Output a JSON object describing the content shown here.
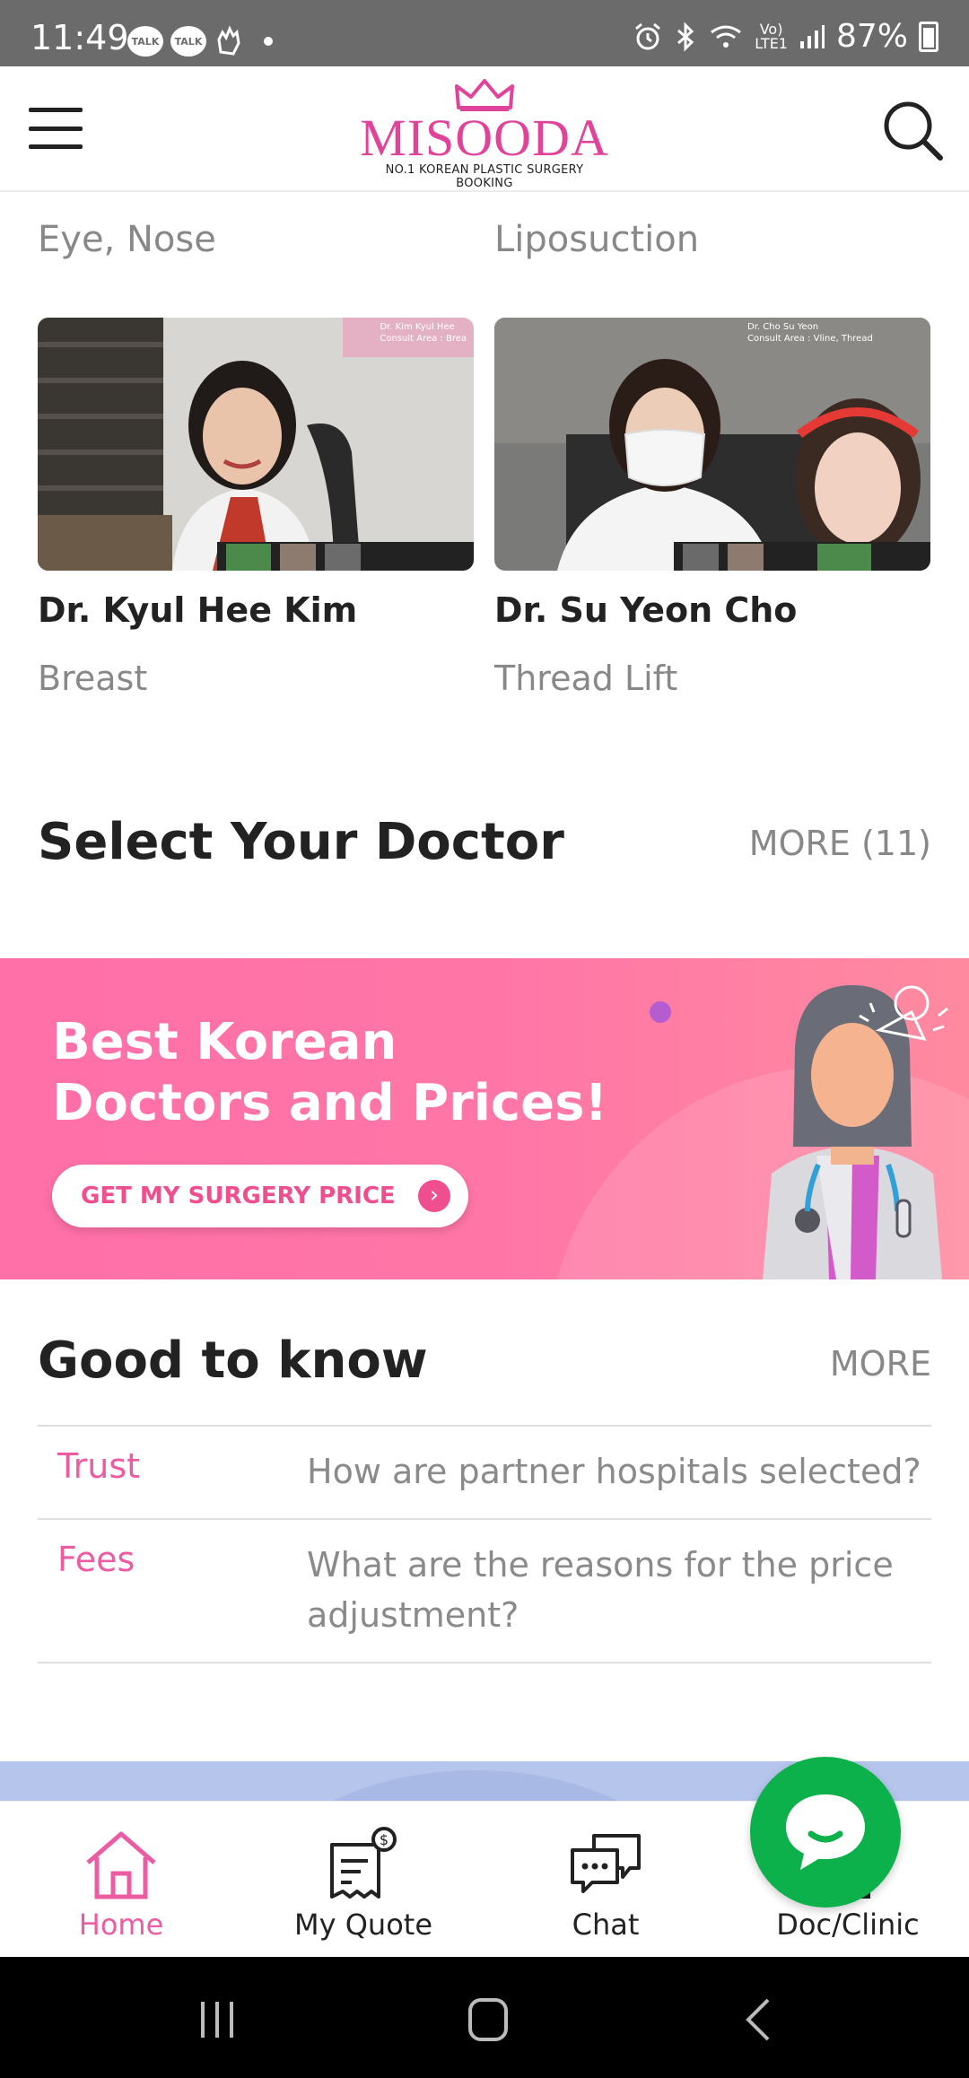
{
  "status_bar": {
    "time": "11:49",
    "notif_badge_1": "TALK",
    "notif_badge_2": "TALK",
    "network_top": "Vo)",
    "network_bottom": "LTE1",
    "battery": "87%"
  },
  "header": {
    "logo_text": "MISOODA",
    "logo_tagline": "NO.1 KOREAN PLASTIC SURGERY BOOKING",
    "brand_color": "#e0449a"
  },
  "doctors_prev_row": [
    {
      "specialty": "Eye, Nose"
    },
    {
      "specialty": "Liposuction"
    }
  ],
  "doctors": [
    {
      "name": "Dr. Kyul Hee Kim",
      "specialty": "Breast",
      "thumb_caption_1": "Dr. Kim Kyul Hee",
      "thumb_caption_2": "Consult Area : Brea"
    },
    {
      "name": "Dr. Su Yeon Cho",
      "specialty": "Thread Lift",
      "thumb_caption_1": "Dr. Cho Su Yeon",
      "thumb_caption_2": "Consult Area : Vline, Thread"
    }
  ],
  "select_doctor": {
    "title": "Select Your Doctor",
    "more_label": "MORE (11)"
  },
  "banner": {
    "headline_line1": "Best Korean",
    "headline_line2": "Doctors and Prices!",
    "cta_label": "GET MY SURGERY PRICE"
  },
  "good_to_know": {
    "title": "Good to know",
    "more_label": "MORE",
    "items": [
      {
        "category": "Trust",
        "question": "How are partner hospitals selected?"
      },
      {
        "category": "Fees",
        "question": "What are the reasons for the price adjustment?"
      }
    ]
  },
  "bottom_nav": {
    "items": [
      {
        "label": "Home",
        "icon": "home-icon",
        "active": true
      },
      {
        "label": "My Quote",
        "icon": "quote-receipt-icon",
        "active": false
      },
      {
        "label": "Chat",
        "icon": "chat-bubbles-icon",
        "active": false
      },
      {
        "label": "Doc/Clinic",
        "icon": "clinic-icon",
        "active": false
      }
    ],
    "active_color": "#ec5ca3"
  },
  "chat_fab": {
    "icon": "chat-fab-icon",
    "color": "#0db14b"
  }
}
